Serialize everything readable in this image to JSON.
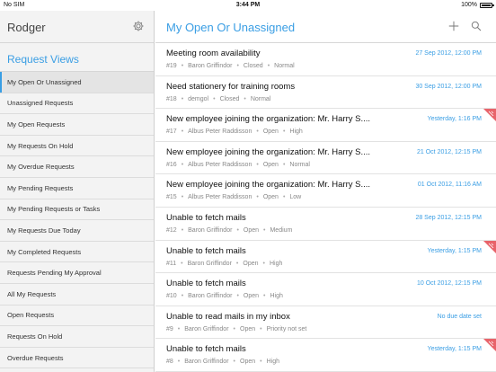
{
  "status_bar": {
    "carrier": "No SIM",
    "time": "3:44 PM",
    "battery": "100%"
  },
  "sidebar": {
    "user": "Rodger",
    "section_title": "Request Views",
    "items": [
      {
        "label": "My Open Or Unassigned",
        "active": true
      },
      {
        "label": "Unassigned Requests"
      },
      {
        "label": "My Open Requests"
      },
      {
        "label": "My Requests On Hold"
      },
      {
        "label": "My Overdue Requests"
      },
      {
        "label": "My Pending Requests"
      },
      {
        "label": "My Pending Requests or Tasks"
      },
      {
        "label": "My Requests Due Today"
      },
      {
        "label": "My Completed Requests"
      },
      {
        "label": "Requests Pending My Approval"
      },
      {
        "label": "All My Requests"
      },
      {
        "label": "Open Requests"
      },
      {
        "label": "Requests On Hold"
      },
      {
        "label": "Overdue Requests"
      }
    ]
  },
  "main": {
    "title": "My Open Or Unassigned",
    "requests": [
      {
        "subject": "Meeting room availability",
        "date": "27 Sep 2012, 12:00 PM",
        "meta": [
          "#19",
          "Baron Griffindor",
          "Closed",
          "Normal"
        ],
        "flagged": false
      },
      {
        "subject": "Need stationery for training rooms",
        "date": "30 Sep 2012, 12:00 PM",
        "meta": [
          "#18",
          "demgol",
          "Closed",
          "Normal"
        ],
        "flagged": false
      },
      {
        "subject": "New employee joining the organization: Mr. Harry S....",
        "date": "Yesterday, 1:16 PM",
        "meta": [
          "#17",
          "Albus Peter Raddisson",
          "Open",
          "High"
        ],
        "flagged": true
      },
      {
        "subject": "New employee joining the organization: Mr. Harry S....",
        "date": "21 Oct 2012, 12:15 PM",
        "meta": [
          "#16",
          "Albus Peter Raddisson",
          "Open",
          "Normal"
        ],
        "flagged": false
      },
      {
        "subject": "New employee joining the organization: Mr. Harry S....",
        "date": "01 Oct 2012, 11:16 AM",
        "meta": [
          "#15",
          "Albus Peter Raddisson",
          "Open",
          "Low"
        ],
        "flagged": false
      },
      {
        "subject": "Unable to fetch mails",
        "date": "28 Sep 2012, 12:15 PM",
        "meta": [
          "#12",
          "Baron Griffindor",
          "Open",
          "Medium"
        ],
        "flagged": false
      },
      {
        "subject": "Unable to fetch mails",
        "date": "Yesterday, 1:15 PM",
        "meta": [
          "#11",
          "Baron Griffindor",
          "Open",
          "High"
        ],
        "flagged": true
      },
      {
        "subject": "Unable to fetch mails",
        "date": "10 Oct 2012, 12:15 PM",
        "meta": [
          "#10",
          "Baron Griffindor",
          "Open",
          "High"
        ],
        "flagged": false
      },
      {
        "subject": "Unable to read mails in my inbox",
        "date": "No due date set",
        "meta": [
          "#9",
          "Baron Griffindor",
          "Open",
          "Priority not set"
        ],
        "flagged": false
      },
      {
        "subject": "Unable to fetch mails",
        "date": "Yesterday, 1:15 PM",
        "meta": [
          "#8",
          "Baron Griffindor",
          "Open",
          "High"
        ],
        "flagged": true
      }
    ]
  },
  "colors": {
    "accent": "#3a9ee4",
    "overdue_flag": "#e8636a"
  },
  "icons": {
    "settings": "gear-icon",
    "add": "plus-icon",
    "search": "search-icon",
    "overdue": "overdue-flag-icon"
  }
}
